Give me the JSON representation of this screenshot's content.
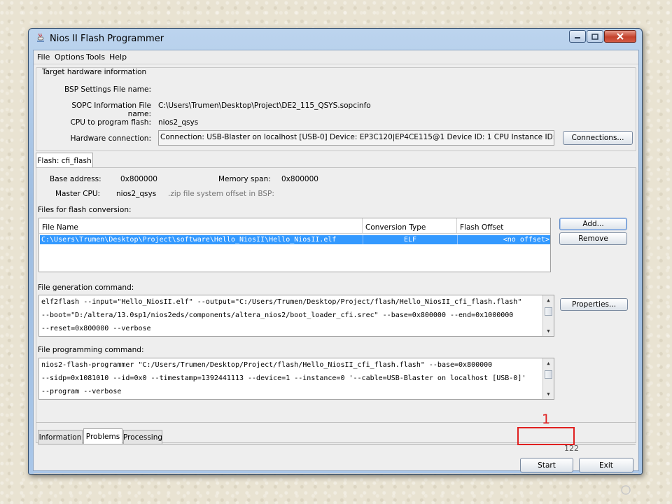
{
  "window": {
    "title": "Nios II Flash Programmer"
  },
  "menu": [
    "File",
    "Options",
    "Tools",
    "Help"
  ],
  "target": {
    "group_title": "Target hardware information",
    "bsp_label": "BSP Settings File name:",
    "bsp_value": "",
    "sopc_label": "SOPC Information File name:",
    "sopc_value": "C:\\Users\\Trumen\\Desktop\\Project\\DE2_115_QSYS.sopcinfo",
    "cpu_label": "CPU to program flash:",
    "cpu_value": "nios2_qsys",
    "hw_label": "Hardware connection:",
    "hw_value": "Connection: USB-Blaster on localhost [USB-0]    Device: EP3C120|EP4CE115@1    Device ID: 1    CPU Instance ID: ...",
    "connections_button": "Connections..."
  },
  "flash_tab": {
    "label": "Flash: cfi_flash",
    "base_label": "Base address:",
    "base_value": "0x800000",
    "span_label": "Memory span:",
    "span_value": "0x800000",
    "master_label": "Master CPU:",
    "master_value": "nios2_qsys",
    "zip_label": ".zip file system offset in BSP:"
  },
  "files": {
    "section_label": "Files for flash conversion:",
    "columns": [
      "File Name",
      "Conversion Type",
      "Flash Offset"
    ],
    "rows": [
      {
        "file": "C:\\Users\\Trumen\\Desktop\\Project\\software\\Hello_NiosII\\Hello_NiosII.elf",
        "type": "ELF",
        "offset": "<no offset>"
      }
    ],
    "add_button": "Add...",
    "remove_button": "Remove"
  },
  "generation": {
    "label": "File generation command:",
    "lines": [
      "elf2flash --input=\"Hello_NiosII.elf\" --output=\"C:/Users/Trumen/Desktop/Project/flash/Hello_NiosII_cfi_flash.flash\"",
      "--boot=\"D:/altera/13.0sp1/nios2eds/components/altera_nios2/boot_loader_cfi.srec\" --base=0x800000 --end=0x1000000",
      "--reset=0x800000 --verbose"
    ],
    "properties_button": "Properties..."
  },
  "programming": {
    "label": "File programming command:",
    "lines": [
      "nios2-flash-programmer \"C:/Users/Trumen/Desktop/Project/flash/Hello_NiosII_cfi_flash.flash\" --base=0x800000",
      "--sidp=0x1081010 --id=0x0 --timestamp=1392441113 --device=1 --instance=0 '--cable=USB-Blaster on localhost [USB-0]'",
      "--program --verbose"
    ]
  },
  "bottom_tabs": [
    "Information",
    "Problems",
    "Processing"
  ],
  "actions": {
    "start": "Start",
    "exit": "Exit"
  },
  "annotation": {
    "step": "1",
    "page": "122"
  },
  "colors": {
    "selection": "#3399ff",
    "annotation": "#e02020"
  }
}
